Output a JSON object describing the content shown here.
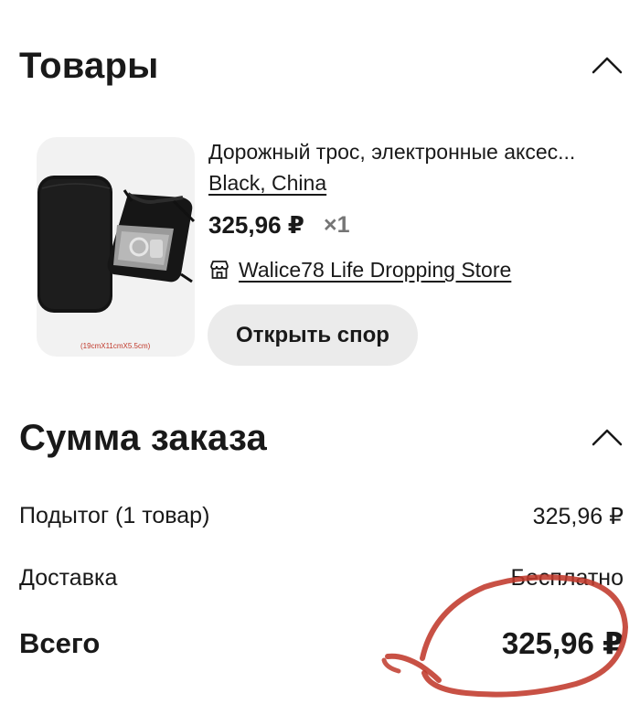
{
  "products_section": {
    "title": "Товары"
  },
  "product": {
    "image_icon": "travel-cable-organizer-bag-image",
    "image_caption": "(19cmX11cmX5.5cm)",
    "title": "Дорожный трос, электронные аксес...",
    "variant": "Black, China",
    "price": "325,96 ₽",
    "quantity": "×1",
    "store_icon": "store-icon",
    "store_name": "Walice78 Life Dropping Store",
    "dispute_button": "Открыть спор"
  },
  "summary_section": {
    "title": "Сумма заказа",
    "subtotal_label": "Подытог (1 товар)",
    "subtotal_value": "325,96 ₽",
    "shipping_label": "Доставка",
    "shipping_value": "Бесплатно",
    "total_label": "Всего",
    "total_value": "325,96 ₽"
  },
  "colors": {
    "text": "#191919",
    "muted": "#757575",
    "button_bg": "#ebebeb",
    "annotation_red": "#c0392b"
  }
}
